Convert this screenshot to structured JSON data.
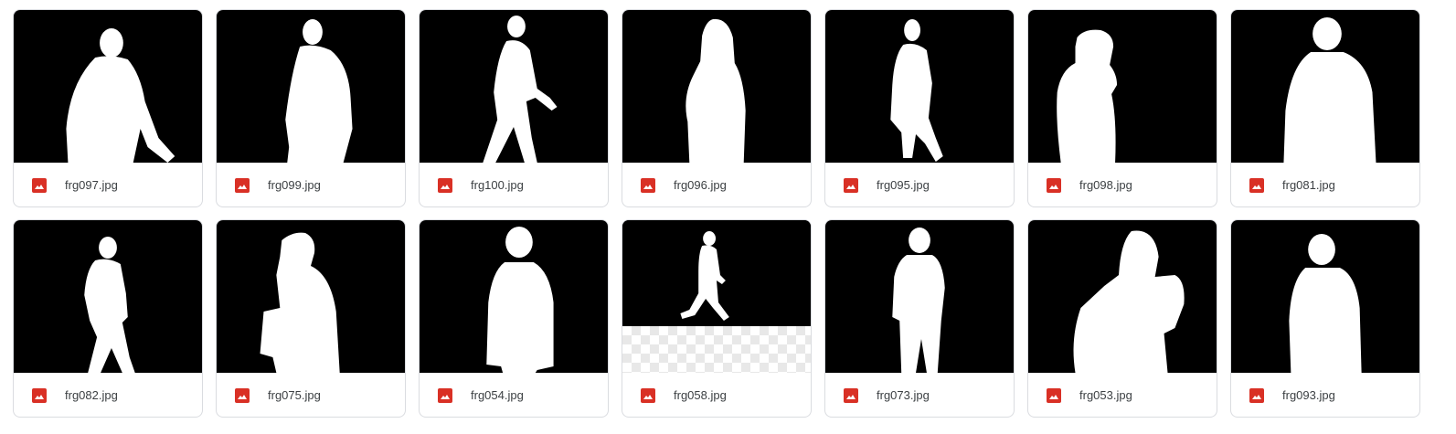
{
  "files": [
    {
      "name": "frg097.jpg",
      "icon": "image-file-icon"
    },
    {
      "name": "frg099.jpg",
      "icon": "image-file-icon"
    },
    {
      "name": "frg100.jpg",
      "icon": "image-file-icon"
    },
    {
      "name": "frg096.jpg",
      "icon": "image-file-icon"
    },
    {
      "name": "frg095.jpg",
      "icon": "image-file-icon"
    },
    {
      "name": "frg098.jpg",
      "icon": "image-file-icon"
    },
    {
      "name": "frg081.jpg",
      "icon": "image-file-icon"
    },
    {
      "name": "frg082.jpg",
      "icon": "image-file-icon"
    },
    {
      "name": "frg075.jpg",
      "icon": "image-file-icon"
    },
    {
      "name": "frg054.jpg",
      "icon": "image-file-icon"
    },
    {
      "name": "frg058.jpg",
      "icon": "image-file-icon"
    },
    {
      "name": "frg073.jpg",
      "icon": "image-file-icon"
    },
    {
      "name": "frg053.jpg",
      "icon": "image-file-icon"
    },
    {
      "name": "frg093.jpg",
      "icon": "image-file-icon"
    }
  ],
  "colors": {
    "image_icon": "#d93025",
    "card_border": "#dadce0",
    "text": "#3c4043",
    "thumbnail_background": "#000000",
    "silhouette": "#ffffff"
  }
}
